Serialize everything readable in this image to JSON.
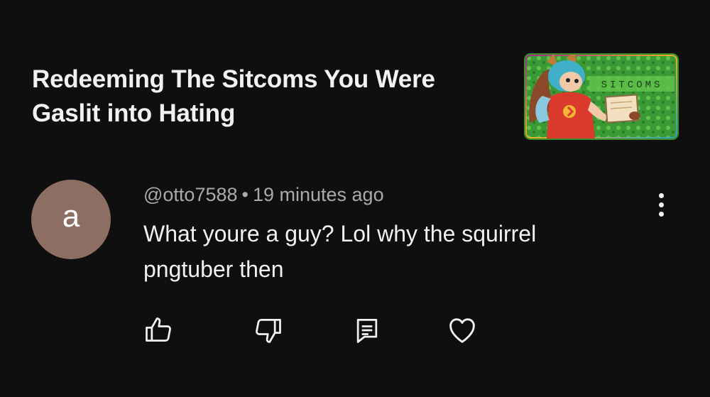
{
  "video": {
    "title": "Redeeming The Sitcoms You Were Gaslit into Hating",
    "thumbnail": {
      "overlay_text": "SITCOMS",
      "background_color": "#3c9a36"
    }
  },
  "comment": {
    "avatar_letter": "a",
    "avatar_color": "#8d6e63",
    "author": "@otto7588",
    "separator": "•",
    "time": "19 minutes ago",
    "text": "What youre a guy? Lol why the squirrel pngtuber then"
  },
  "icons": {
    "more": "more-vertical-icon",
    "like": "thumbs-up-icon",
    "dislike": "thumbs-down-icon",
    "reply": "reply-comment-icon",
    "heart": "heart-icon"
  }
}
